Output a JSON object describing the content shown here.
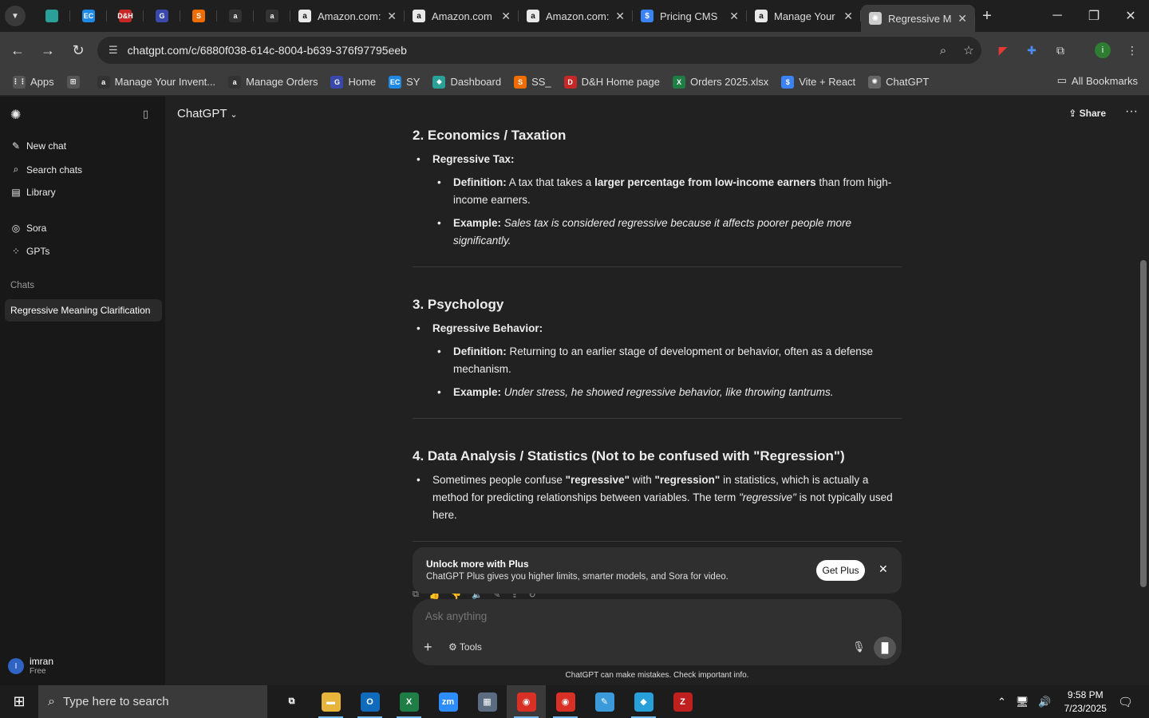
{
  "browser": {
    "pinned": [
      {
        "name": "pinned-edge-tab",
        "icon": "diamond-icon",
        "label": "",
        "color": "#2aa198"
      },
      {
        "name": "pinned-ec-tab",
        "icon": "ec-logo-icon",
        "label": "EC",
        "color": "#1e88e5"
      },
      {
        "name": "pinned-dh-tab",
        "icon": "dh-logo-icon",
        "label": "D&H",
        "color": "#c62828"
      },
      {
        "name": "pinned-g-tab",
        "icon": "g-icon",
        "label": "G",
        "color": "#3949ab"
      },
      {
        "name": "pinned-stack-tab",
        "icon": "stack-icon",
        "label": "S",
        "color": "#ef6c00"
      },
      {
        "name": "pinned-amazon-tab-1",
        "icon": "amazon-icon",
        "label": "a",
        "color": "#333333"
      },
      {
        "name": "pinned-amazon-tab-2",
        "icon": "amazon-icon",
        "label": "a",
        "color": "#333333"
      }
    ],
    "tabs": [
      {
        "title": "Amazon.com:",
        "icon": "amazon-icon",
        "fav": "a",
        "color": "#e8e8e8"
      },
      {
        "title": "Amazon.com",
        "icon": "amazon-icon",
        "fav": "a",
        "color": "#e8e8e8"
      },
      {
        "title": "Amazon.com:",
        "icon": "amazon-icon",
        "fav": "a",
        "color": "#e8e8e8"
      },
      {
        "title": "Pricing CMS",
        "icon": "dollar-icon",
        "fav": "$",
        "color": "#3b82f6"
      },
      {
        "title": "Manage Your",
        "icon": "amazon-icon",
        "fav": "a",
        "color": "#e8e8e8"
      },
      {
        "title": "Regressive M",
        "icon": "openai-icon",
        "fav": "✺",
        "color": "#cccccc",
        "active": true
      }
    ],
    "url": "chatgpt.com/c/6880f038-614c-8004-b639-376f97795eeb",
    "bookmarks": [
      {
        "label": "Apps",
        "icon": "apps-grid-icon",
        "fav": "⋮⋮",
        "color": "#555555"
      },
      {
        "label": "",
        "icon": "tab-groups-icon",
        "fav": "⊞",
        "color": "#555555"
      },
      {
        "label": "Manage Your Invent...",
        "icon": "amazon-icon",
        "fav": "a",
        "color": "#333333"
      },
      {
        "label": "Manage Orders",
        "icon": "amazon-icon",
        "fav": "a",
        "color": "#333333"
      },
      {
        "label": "Home",
        "icon": "g-icon",
        "fav": "G",
        "color": "#3949ab"
      },
      {
        "label": "SY",
        "icon": "ec-logo-icon",
        "fav": "EC",
        "color": "#1e88e5"
      },
      {
        "label": "Dashboard",
        "icon": "diamond-icon",
        "fav": "◆",
        "color": "#2aa198"
      },
      {
        "label": "SS_",
        "icon": "stack-icon",
        "fav": "S",
        "color": "#ef6c00"
      },
      {
        "label": "D&H Home page",
        "icon": "dh-logo-icon",
        "fav": "D",
        "color": "#c62828"
      },
      {
        "label": "Orders 2025.xlsx",
        "icon": "excel-icon",
        "fav": "X",
        "color": "#1e7e45"
      },
      {
        "label": "Vite + React",
        "icon": "dollar-icon",
        "fav": "$",
        "color": "#3b82f6"
      },
      {
        "label": "ChatGPT",
        "icon": "openai-icon",
        "fav": "✺",
        "color": "#666666"
      }
    ],
    "all_bookmarks": "All Bookmarks"
  },
  "sidebar": {
    "nav": [
      {
        "label": "New chat",
        "icon": "new-chat-icon"
      },
      {
        "label": "Search chats",
        "icon": "search-icon"
      },
      {
        "label": "Library",
        "icon": "library-icon"
      },
      {
        "label": "Sora",
        "icon": "sora-icon"
      },
      {
        "label": "GPTs",
        "icon": "gpts-grid-icon"
      }
    ],
    "chats_heading": "Chats",
    "chats": [
      {
        "label": "Regressive Meaning Clarification"
      }
    ],
    "user": {
      "initial": "I",
      "name": "imran",
      "plan": "Free"
    }
  },
  "header": {
    "model": "ChatGPT",
    "share": "Share"
  },
  "content": {
    "s2": {
      "heading": "2. Economics / Taxation",
      "bullet": "Regressive Tax:",
      "def_label": "Definition:",
      "def_a": " A tax that takes a ",
      "def_b": "larger percentage from low-income earners",
      "def_c": " than from high-income earners.",
      "ex_label": "Example:",
      "ex_text": " Sales tax is considered regressive because it affects poorer people more significantly."
    },
    "s3": {
      "heading": "3. Psychology",
      "bullet": "Regressive Behavior:",
      "def_label": "Definition:",
      "def_a": " Returning to an earlier stage of development or behavior, often as a defense mechanism.",
      "ex_label": "Example:",
      "ex_text": " Under stress, he showed regressive behavior, like throwing tantrums."
    },
    "s4": {
      "heading": "4. Data Analysis / Statistics (Not to be confused with \"Regression\")",
      "p_a": "Sometimes people confuse ",
      "p_b": "\"regressive\"",
      "p_c": " with ",
      "p_d": "\"regression\"",
      "p_e": " in statistics, which is actually a method for predicting relationships between variables. The term ",
      "p_f": "\"regressive\"",
      "p_g": " is not typically used here."
    }
  },
  "upsell": {
    "title": "Unlock more with Plus",
    "desc": "ChatGPT Plus gives you higher limits, smarter models, and Sora for video.",
    "button": "Get Plus"
  },
  "composer": {
    "placeholder": "Ask anything",
    "tools": "Tools"
  },
  "disclaimer": "ChatGPT can make mistakes. Check important info.",
  "taskbar": {
    "search": "Type here to search",
    "apps": [
      {
        "name": "task-view",
        "icon": "task-view-icon",
        "fav": "⧉",
        "color": "#1c1c1c"
      },
      {
        "name": "file-explorer",
        "icon": "folder-icon",
        "fav": "▬",
        "color": "#e7b43c",
        "run": true
      },
      {
        "name": "outlook",
        "icon": "outlook-icon",
        "fav": "O",
        "color": "#0f6cbd",
        "run": true
      },
      {
        "name": "excel",
        "icon": "excel-icon",
        "fav": "X",
        "color": "#1e7e45",
        "run": true
      },
      {
        "name": "zoom",
        "icon": "zoom-icon",
        "fav": "zm",
        "color": "#2d8cff"
      },
      {
        "name": "calculator",
        "icon": "calculator-icon",
        "fav": "▦",
        "color": "#5b6b80"
      },
      {
        "name": "chrome",
        "icon": "chrome-icon",
        "fav": "◉",
        "color": "#d93025",
        "run": true,
        "act": true
      },
      {
        "name": "chrome-2",
        "icon": "chrome-icon",
        "fav": "◉",
        "color": "#d93025",
        "run": true
      },
      {
        "name": "notepad",
        "icon": "notepad-icon",
        "fav": "✎",
        "color": "#3b9ad9"
      },
      {
        "name": "vscode",
        "icon": "code-icon",
        "fav": "◆",
        "color": "#27a0d9",
        "run": true
      },
      {
        "name": "filezilla",
        "icon": "filezilla-icon",
        "fav": "Z",
        "color": "#bf1f1f"
      }
    ],
    "time": "9:58 PM",
    "date": "7/23/2025"
  }
}
